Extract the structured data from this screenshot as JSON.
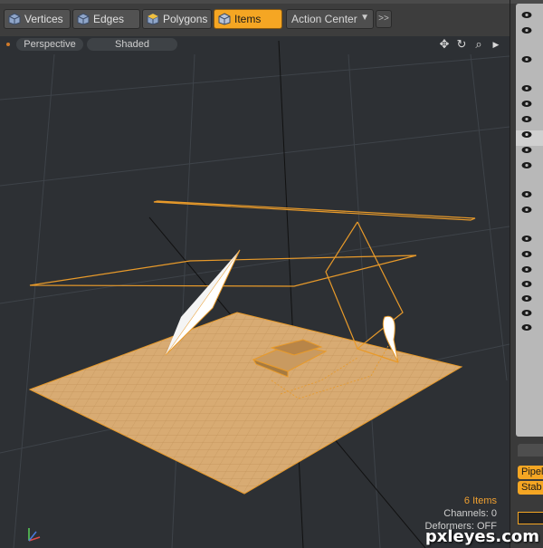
{
  "toolbar": {
    "buttons": [
      {
        "label": "Vertices",
        "icon": "vertices-cube-icon"
      },
      {
        "label": "Edges",
        "icon": "edges-cube-icon"
      },
      {
        "label": "Polygons",
        "icon": "polygons-cube-icon"
      },
      {
        "label": "Items",
        "icon": "items-cube-icon",
        "active": true
      }
    ],
    "action_center": "Action Center",
    "more": ">>"
  },
  "viewport": {
    "view_mode": "Perspective",
    "shading": "Shaded",
    "nav_icons": [
      "move-view-icon",
      "rotate-view-icon",
      "zoom-view-icon",
      "more-arrow-icon"
    ],
    "info": {
      "items": "6 Items",
      "channels": "Channels: 0",
      "deformers": "Deformers: OFF"
    }
  },
  "right_panel": {
    "pipeline_label": "Pipel",
    "stab_label": "Stab"
  },
  "watermark": "pxleyes.com",
  "colors": {
    "accent": "#f5a623",
    "selection_wire": "#e89a2a",
    "ground_fill": "#d8ab73",
    "viewport_bg": "#2d3034"
  }
}
